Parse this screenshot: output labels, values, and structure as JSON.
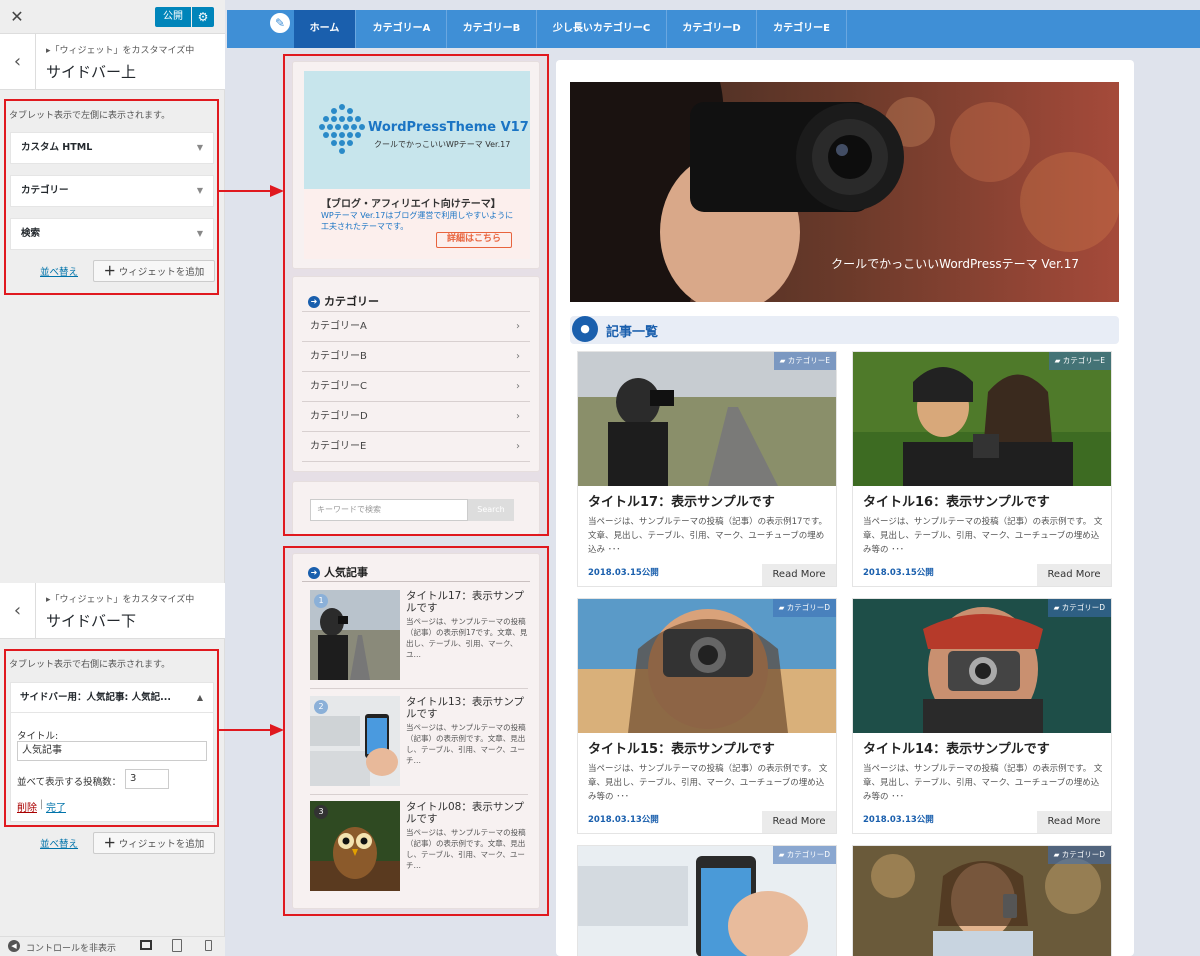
{
  "customizer": {
    "close_label": "✕",
    "publish_label": "公開",
    "top_section": {
      "crumb": "▸「ウィジェット」をカスタマイズ中",
      "title": "サイドバー上",
      "description": "タブレット表示で左側に表示されます。",
      "widgets": [
        {
          "label": "カスタム HTML"
        },
        {
          "label": "カテゴリー"
        },
        {
          "label": "検索"
        }
      ],
      "reorder_label": "並べ替え",
      "add_widget_label": "ウィジェットを追加"
    },
    "bottom_section": {
      "crumb": "▸「ウィジェット」をカスタマイズ中",
      "title": "サイドバー下",
      "description": "タブレット表示で右側に表示されます。",
      "expanded_widget": {
        "header": "サイドバー用：人気記事: 人気記...",
        "title_label": "タイトル:",
        "title_value": "人気記事",
        "count_label": "並べて表示する投稿数：",
        "count_value": "3",
        "delete_label": "削除",
        "separator": "|",
        "done_label": "完了"
      },
      "reorder_label": "並べ替え",
      "add_widget_label": "ウィジェットを追加"
    },
    "footer": {
      "hide_controls_label": "コントロールを非表示"
    }
  },
  "preview": {
    "nav": [
      {
        "label": "ホーム",
        "active": true
      },
      {
        "label": "カテゴリーA"
      },
      {
        "label": "カテゴリーB"
      },
      {
        "label": "少し長いカテゴリーC"
      },
      {
        "label": "カテゴリーD"
      },
      {
        "label": "カテゴリーE"
      }
    ],
    "banner": {
      "logo_text_main": "WordPressTheme V17",
      "logo_text_sub": "クールでかっこいいWPテーマ Ver.17",
      "heading": "【ブログ・アフィリエイト向けテーマ】",
      "body": "WPテーマ Ver.17はブログ運営で利用しやすいように工夫されたテーマです。",
      "cta": "詳細はこちら"
    },
    "category_widget": {
      "title": "カテゴリー",
      "items": [
        "カテゴリーA",
        "カテゴリーB",
        "カテゴリーC",
        "カテゴリーD",
        "カテゴリーE"
      ]
    },
    "search_widget": {
      "placeholder": "キーワードで検索",
      "button": "Search"
    },
    "popular_widget": {
      "title": "人気記事",
      "items": [
        {
          "rank": "1",
          "title": "タイトル17：表示サンプルです",
          "excerpt": "当ページは、サンプルテーマの投稿（記事）の表示例17です。文章、見出し、テーブル、引用、マーク、ユ…"
        },
        {
          "rank": "2",
          "title": "タイトル13：表示サンプルです",
          "excerpt": "当ページは、サンプルテーマの投稿（記事）の表示例です。文章、見出し、テーブル、引用、マーク、ユーチ…"
        },
        {
          "rank": "3",
          "title": "タイトル08：表示サンプルです",
          "excerpt": "当ページは、サンプルテーマの投稿（記事）の表示例です。文章、見出し、テーブル、引用、マーク、ユーチ…"
        }
      ]
    },
    "hero_caption": "クールでかっこいいWordPressテーマ Ver.17",
    "section_title": "記事一覧",
    "posts": [
      {
        "category": "カテゴリーE",
        "title": "タイトル17：表示サンプルです",
        "excerpt": "当ページは、サンプルテーマの投稿（記事）の表示例17です。 文章、見出し、テーブル、引用、マーク、ユーチューブの埋め込み ･･･",
        "date": "2018.03.15公開",
        "more": "Read More"
      },
      {
        "category": "カテゴリーE",
        "title": "タイトル16：表示サンプルです",
        "excerpt": "当ページは、サンプルテーマの投稿（記事）の表示例です。 文章、見出し、テーブル、引用、マーク、ユーチューブの埋め込み等の ･･･",
        "date": "2018.03.15公開",
        "more": "Read More"
      },
      {
        "category": "カテゴリーD",
        "title": "タイトル15：表示サンプルです",
        "excerpt": "当ページは、サンプルテーマの投稿（記事）の表示例です。 文章、見出し、テーブル、引用、マーク、ユーチューブの埋め込み等の ･･･",
        "date": "2018.03.13公開",
        "more": "Read More"
      },
      {
        "category": "カテゴリーD",
        "title": "タイトル14：表示サンプルです",
        "excerpt": "当ページは、サンプルテーマの投稿（記事）の表示例です。 文章、見出し、テーブル、引用、マーク、ユーチューブの埋め込み等の ･･･",
        "date": "2018.03.13公開",
        "more": "Read More"
      },
      {
        "category": "カテゴリーD"
      },
      {
        "category": "カテゴリーD"
      }
    ]
  },
  "colors": {
    "accent_blue": "#1a5fad",
    "nav_blue": "#3f8fd6",
    "annotation_red": "#e0191f",
    "wp_button": "#0085ba"
  }
}
